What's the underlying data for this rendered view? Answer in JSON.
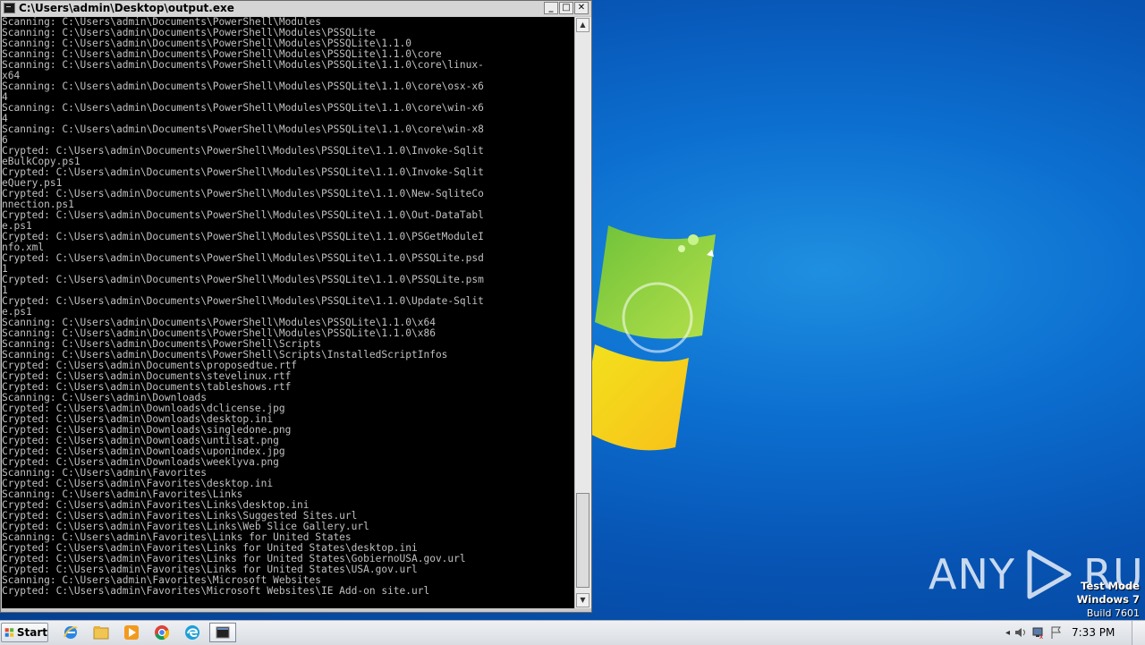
{
  "window": {
    "title": "C:\\Users\\admin\\Desktop\\output.exe",
    "buttons": {
      "minimize": "_",
      "maximize": "□",
      "close": "✕"
    },
    "console_lines": [
      "Scanning: C:\\Users\\admin\\Documents\\PowerShell\\Modules",
      "Scanning: C:\\Users\\admin\\Documents\\PowerShell\\Modules\\PSSQLite",
      "Scanning: C:\\Users\\admin\\Documents\\PowerShell\\Modules\\PSSQLite\\1.1.0",
      "Scanning: C:\\Users\\admin\\Documents\\PowerShell\\Modules\\PSSQLite\\1.1.0\\core",
      "Scanning: C:\\Users\\admin\\Documents\\PowerShell\\Modules\\PSSQLite\\1.1.0\\core\\linux-",
      "x64",
      "Scanning: C:\\Users\\admin\\Documents\\PowerShell\\Modules\\PSSQLite\\1.1.0\\core\\osx-x6",
      "4",
      "Scanning: C:\\Users\\admin\\Documents\\PowerShell\\Modules\\PSSQLite\\1.1.0\\core\\win-x6",
      "4",
      "Scanning: C:\\Users\\admin\\Documents\\PowerShell\\Modules\\PSSQLite\\1.1.0\\core\\win-x8",
      "6",
      "Crypted: C:\\Users\\admin\\Documents\\PowerShell\\Modules\\PSSQLite\\1.1.0\\Invoke-Sqlit",
      "eBulkCopy.ps1",
      "Crypted: C:\\Users\\admin\\Documents\\PowerShell\\Modules\\PSSQLite\\1.1.0\\Invoke-Sqlit",
      "eQuery.ps1",
      "Crypted: C:\\Users\\admin\\Documents\\PowerShell\\Modules\\PSSQLite\\1.1.0\\New-SqliteCo",
      "nnection.ps1",
      "Crypted: C:\\Users\\admin\\Documents\\PowerShell\\Modules\\PSSQLite\\1.1.0\\Out-DataTabl",
      "e.ps1",
      "Crypted: C:\\Users\\admin\\Documents\\PowerShell\\Modules\\PSSQLite\\1.1.0\\PSGetModuleI",
      "nfo.xml",
      "Crypted: C:\\Users\\admin\\Documents\\PowerShell\\Modules\\PSSQLite\\1.1.0\\PSSQLite.psd",
      "1",
      "Crypted: C:\\Users\\admin\\Documents\\PowerShell\\Modules\\PSSQLite\\1.1.0\\PSSQLite.psm",
      "1",
      "Crypted: C:\\Users\\admin\\Documents\\PowerShell\\Modules\\PSSQLite\\1.1.0\\Update-Sqlit",
      "e.ps1",
      "Scanning: C:\\Users\\admin\\Documents\\PowerShell\\Modules\\PSSQLite\\1.1.0\\x64",
      "Scanning: C:\\Users\\admin\\Documents\\PowerShell\\Modules\\PSSQLite\\1.1.0\\x86",
      "Scanning: C:\\Users\\admin\\Documents\\PowerShell\\Scripts",
      "Scanning: C:\\Users\\admin\\Documents\\PowerShell\\Scripts\\InstalledScriptInfos",
      "Crypted: C:\\Users\\admin\\Documents\\proposedtue.rtf",
      "Crypted: C:\\Users\\admin\\Documents\\stevelinux.rtf",
      "Crypted: C:\\Users\\admin\\Documents\\tableshows.rtf",
      "Scanning: C:\\Users\\admin\\Downloads",
      "Crypted: C:\\Users\\admin\\Downloads\\dclicense.jpg",
      "Crypted: C:\\Users\\admin\\Downloads\\desktop.ini",
      "Crypted: C:\\Users\\admin\\Downloads\\singledone.png",
      "Crypted: C:\\Users\\admin\\Downloads\\untilsat.png",
      "Crypted: C:\\Users\\admin\\Downloads\\uponindex.jpg",
      "Crypted: C:\\Users\\admin\\Downloads\\weeklyva.png",
      "Scanning: C:\\Users\\admin\\Favorites",
      "Crypted: C:\\Users\\admin\\Favorites\\desktop.ini",
      "Scanning: C:\\Users\\admin\\Favorites\\Links",
      "Crypted: C:\\Users\\admin\\Favorites\\Links\\desktop.ini",
      "Crypted: C:\\Users\\admin\\Favorites\\Links\\Suggested Sites.url",
      "Crypted: C:\\Users\\admin\\Favorites\\Links\\Web Slice Gallery.url",
      "Scanning: C:\\Users\\admin\\Favorites\\Links for United States",
      "Crypted: C:\\Users\\admin\\Favorites\\Links for United States\\desktop.ini",
      "Crypted: C:\\Users\\admin\\Favorites\\Links for United States\\GobiernoUSA.gov.url",
      "Crypted: C:\\Users\\admin\\Favorites\\Links for United States\\USA.gov.url",
      "Scanning: C:\\Users\\admin\\Favorites\\Microsoft Websites",
      "Crypted: C:\\Users\\admin\\Favorites\\Microsoft Websites\\IE Add-on site.url"
    ]
  },
  "desktop": {
    "watermark": {
      "left": "ANY",
      "right": "RUN"
    },
    "test_mode": {
      "line1": "Test Mode",
      "line2": "Windows 7",
      "line3": "Build 7601"
    }
  },
  "taskbar": {
    "start_label": "Start",
    "pinned": [
      "internet-explorer-icon",
      "file-explorer-icon",
      "media-player-icon",
      "chrome-icon",
      "edge-icon",
      "console-task-icon"
    ],
    "clock": "7:33 PM"
  },
  "colors": {
    "console_bg": "#000000",
    "console_text": "#c0c0c0",
    "desktop_blue": "#0c6fd0"
  }
}
